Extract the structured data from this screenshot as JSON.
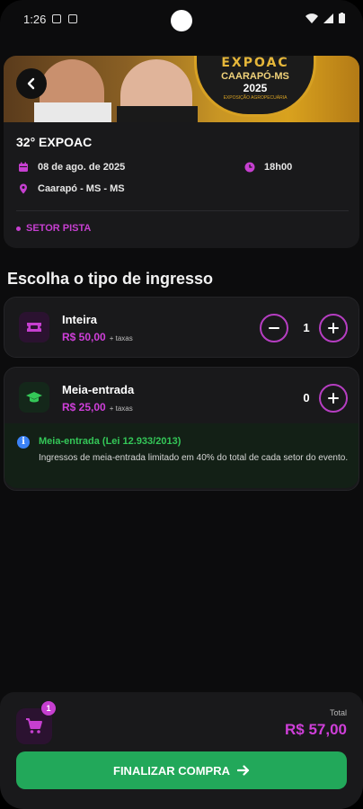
{
  "status_bar": {
    "time": "1:26"
  },
  "event": {
    "title": "32° EXPOAC",
    "date": "08 de ago. de 2025",
    "time": "18h00",
    "location": "Caarapó - MS - MS",
    "sector": "SETOR PISTA",
    "banner": {
      "logo_line1": "EXPOAC",
      "logo_line2": "CAARAPÓ-MS",
      "logo_line3": "2025",
      "logo_line4": "EXPOSIÇÃO AGROPECUÁRIA"
    }
  },
  "section_title": "Escolha o tipo de ingresso",
  "tickets": [
    {
      "name": "Inteira",
      "price": "R$ 50,00",
      "tax": "+ taxas",
      "quantity": "1",
      "icon": "ticket-icon",
      "color": "#c63fd0"
    },
    {
      "name": "Meia-entrada",
      "price": "R$ 25,00",
      "tax": "+ taxas",
      "quantity": "0",
      "icon": "graduation-cap-icon",
      "color": "#34c758"
    }
  ],
  "info": {
    "title": "Meia-entrada (Lei 12.933/2013)",
    "text": "Ingressos de meia-entrada limitado em 40% do total de cada setor do evento."
  },
  "footer": {
    "cart_count": "1",
    "total_label": "Total",
    "total_value": "R$ 57,00",
    "checkout_label": "FINALIZAR COMPRA"
  },
  "colors": {
    "accent": "#c63fd0",
    "success": "#22a85a",
    "background": "#0c0c0d",
    "card": "#19191b"
  }
}
